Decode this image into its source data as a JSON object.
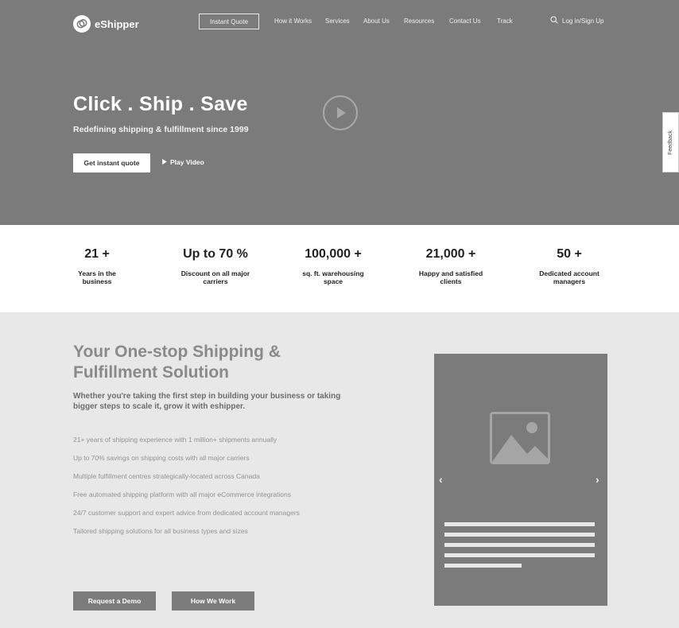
{
  "header": {
    "brand": "eShipper",
    "nav": {
      "instant_quote": "Instant Quote",
      "how_it_works": "How it Works",
      "services": "Services",
      "about_us": "About Us",
      "resources": "Resources",
      "contact_us": "Contact Us",
      "track": "Track"
    },
    "login": "Log in/Sign Up"
  },
  "hero": {
    "title": "Click . Ship . Save",
    "subtitle": "Redefining shipping & fulfillment since 1999",
    "cta": "Get instant quote",
    "play_video": "Play Video"
  },
  "feedback": "Feedback",
  "stats": [
    {
      "value": "21 +",
      "label": "Years in the business"
    },
    {
      "value": "Up to 70 %",
      "label": "Discount on all major carriers"
    },
    {
      "value": "100,000 +",
      "label": "sq. ft. warehousing space"
    },
    {
      "value": "21,000 +",
      "label": "Happy and satisfied clients"
    },
    {
      "value": "50 +",
      "label": "Dedicated account managers"
    }
  ],
  "feature": {
    "title": "Your One-stop Shipping & Fulfillment Solution",
    "subtitle": "Whether you're taking the first step in building your business or taking bigger steps to scale it, grow it with eshipper.",
    "bullets": [
      "21+ years of shipping experience with 1 million+ shipments annually",
      "Up to 70% savings on shipping costs with all major carriers",
      "Multiple fulfillment centres strategically-located across Canada",
      "Free automated shipping platform with all major eCommerce integrations",
      "24/7 customer support and expert advice from dedicated account managers",
      "Tailored shipping solutions for all business types and sizes"
    ],
    "request_demo": "Request a Demo",
    "how_we_work": "How We Work"
  },
  "carousel": {
    "prev_icon": "chevron-left-icon",
    "next_icon": "chevron-right-icon",
    "image_icon": "image-placeholder-icon"
  }
}
